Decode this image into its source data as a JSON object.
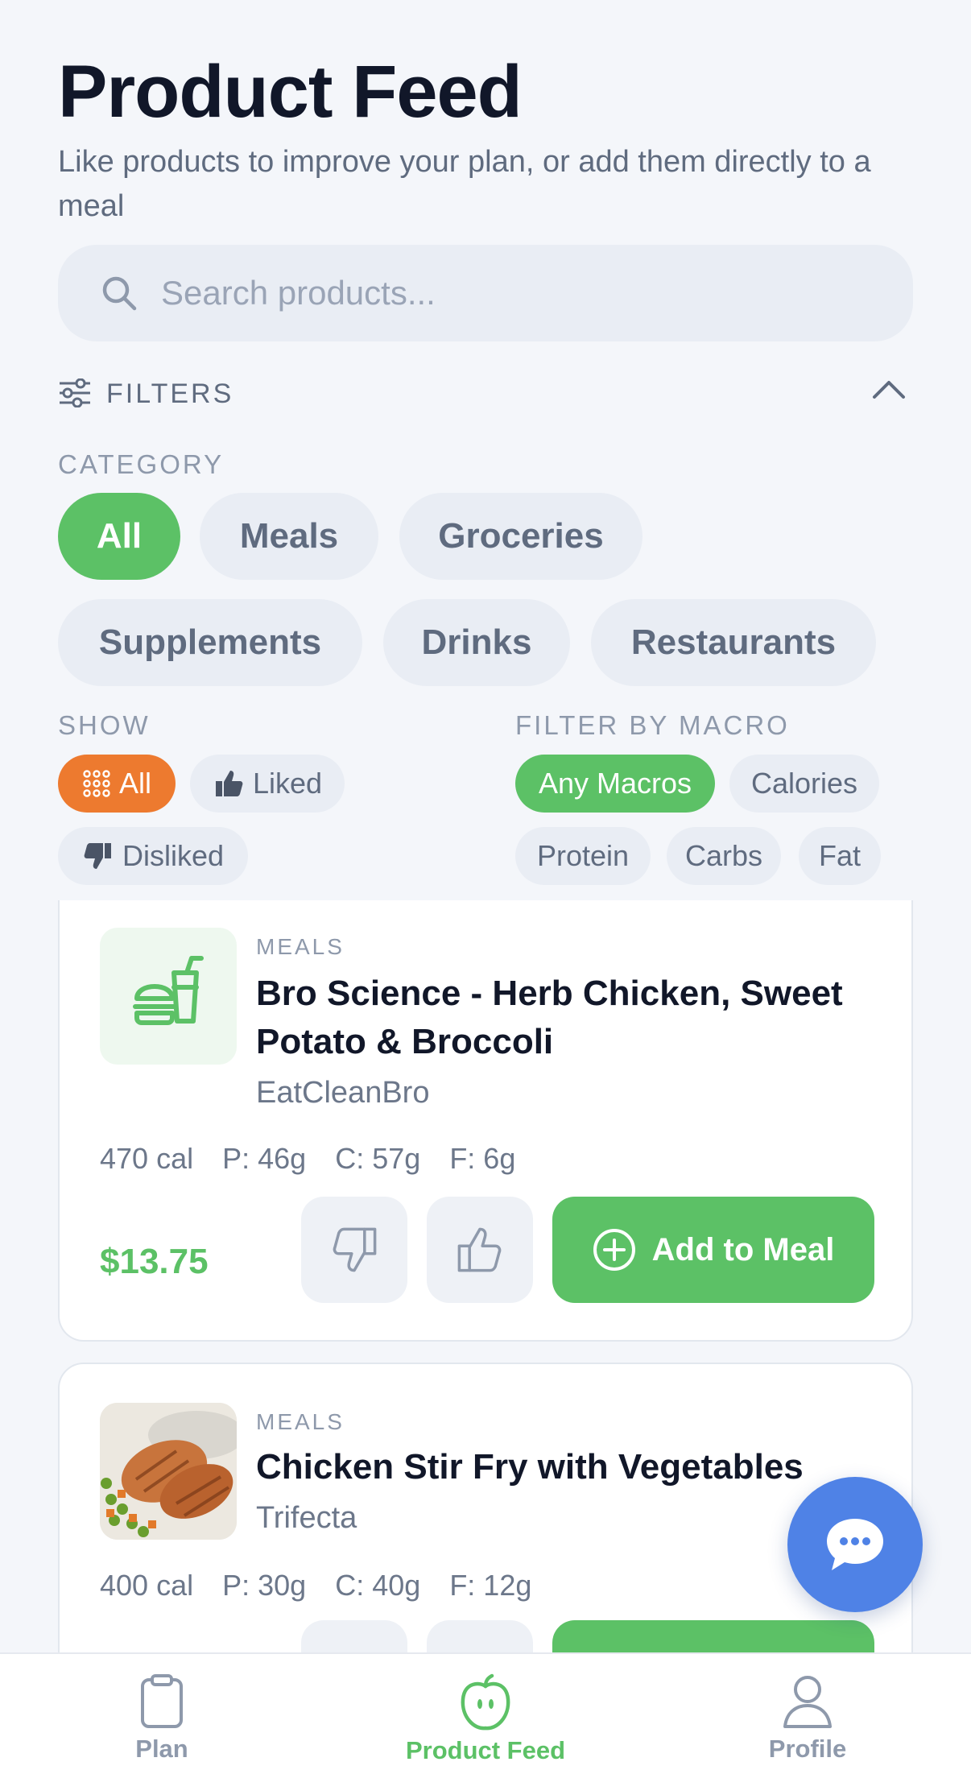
{
  "header": {
    "title": "Product Feed",
    "subtitle": "Like products to improve your plan, or add them directly to a meal"
  },
  "search": {
    "placeholder": "Search products..."
  },
  "filters": {
    "label": "FILTERS",
    "category_label": "CATEGORY",
    "categories": [
      "All",
      "Meals",
      "Groceries",
      "Supplements",
      "Drinks",
      "Restaurants"
    ],
    "selected_category": "All",
    "show_label": "SHOW",
    "show_options": [
      "All",
      "Liked",
      "Disliked"
    ],
    "selected_show": "All",
    "macro_label": "FILTER BY MACRO",
    "macro_options": [
      "Any Macros",
      "Calories",
      "Protein",
      "Carbs",
      "Fat"
    ],
    "selected_macro": "Any Macros"
  },
  "products": [
    {
      "category": "MEALS",
      "title": "Bro Science - Herb Chicken, Sweet Potato & Broccoli",
      "brand": "EatCleanBro",
      "calories": "470 cal",
      "protein": "P: 46g",
      "carbs": "C: 57g",
      "fat": "F: 6g",
      "price": "$13.75",
      "add_label": "Add to Meal",
      "thumb_icon": "fast-food-icon"
    },
    {
      "category": "MEALS",
      "title": "Chicken Stir Fry with Vegetables",
      "brand": "Trifecta",
      "calories": "400 cal",
      "protein": "P: 30g",
      "carbs": "C: 40g",
      "fat": "F: 12g",
      "thumb_icon": "food-photo"
    }
  ],
  "tabbar": {
    "tabs": [
      {
        "label": "Plan",
        "icon": "clipboard-icon"
      },
      {
        "label": "Product Feed",
        "icon": "apple-icon"
      },
      {
        "label": "Profile",
        "icon": "person-icon"
      }
    ],
    "active": "Product Feed"
  },
  "colors": {
    "accent_green": "#5cc166",
    "accent_orange": "#ed7a2f",
    "fab_blue": "#4f82e6",
    "background": "#f4f6fa"
  }
}
